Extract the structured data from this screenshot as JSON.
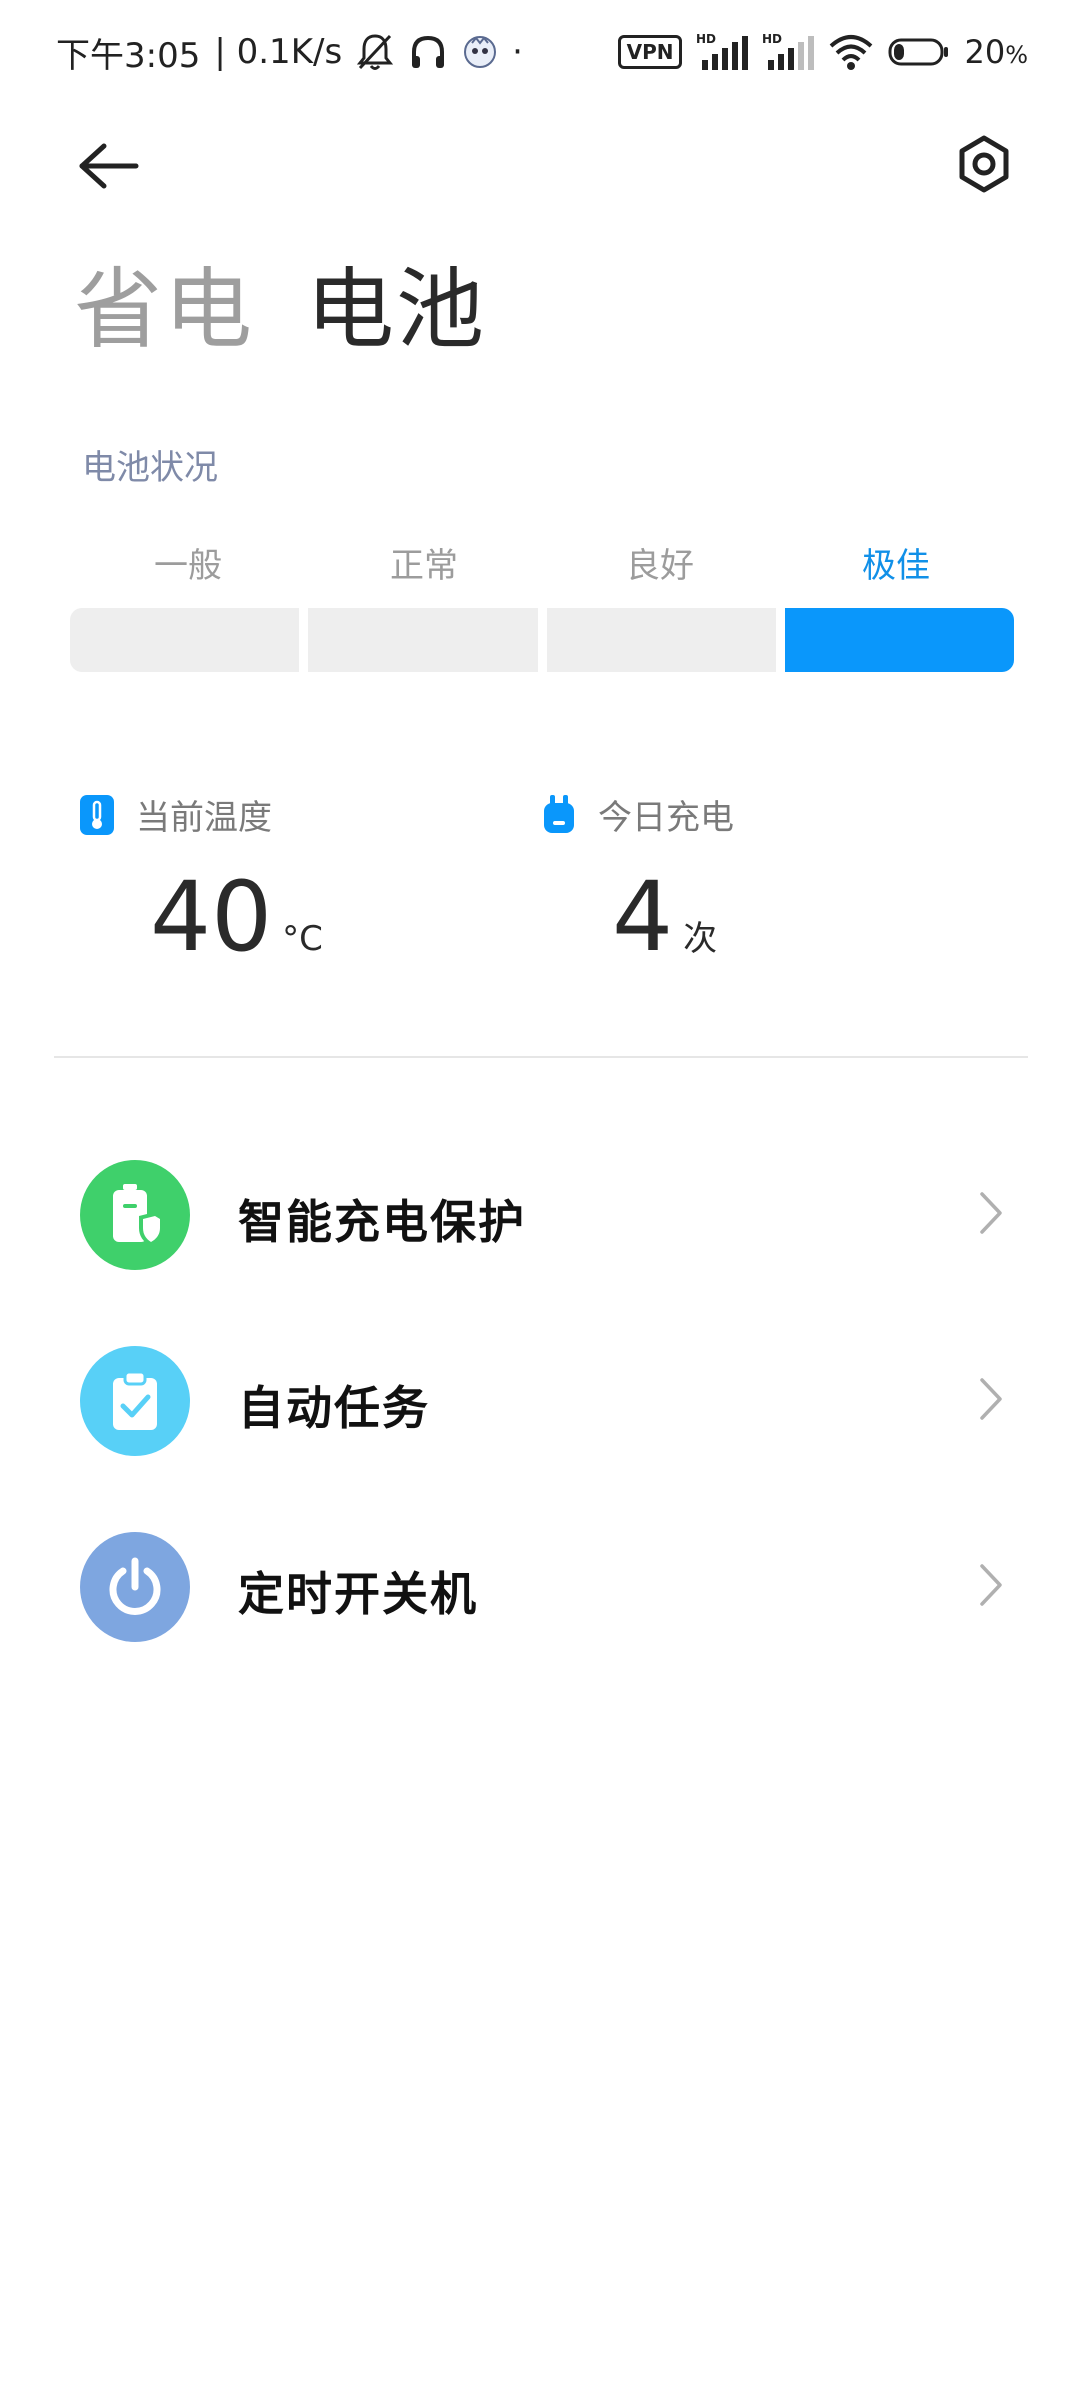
{
  "status_bar": {
    "time": "下午3:05",
    "net_speed": "| 0.1K/s",
    "dot": "·",
    "vpn": "VPN",
    "battery_percent": "20",
    "battery_unit": "%"
  },
  "tabs": [
    {
      "label": "省电",
      "active": false
    },
    {
      "label": "电池",
      "active": true
    }
  ],
  "battery_status": {
    "title": "电池状况",
    "levels": [
      "一般",
      "正常",
      "良好",
      "极佳"
    ],
    "selected_index": 3
  },
  "stats": {
    "temperature": {
      "label": "当前温度",
      "value": "40",
      "unit": "°C"
    },
    "charges_today": {
      "label": "今日充电",
      "value": "4",
      "unit": "次"
    }
  },
  "menu": [
    {
      "label": "智能充电保护",
      "icon": "battery-shield-icon",
      "color": "#3fd06b"
    },
    {
      "label": "自动任务",
      "icon": "clipboard-check-icon",
      "color": "#58d0f7"
    },
    {
      "label": "定时开关机",
      "icon": "power-icon",
      "color": "#7ea6e0"
    }
  ],
  "colors": {
    "accent": "#0a97fb",
    "accent_text": "#1190e8"
  }
}
